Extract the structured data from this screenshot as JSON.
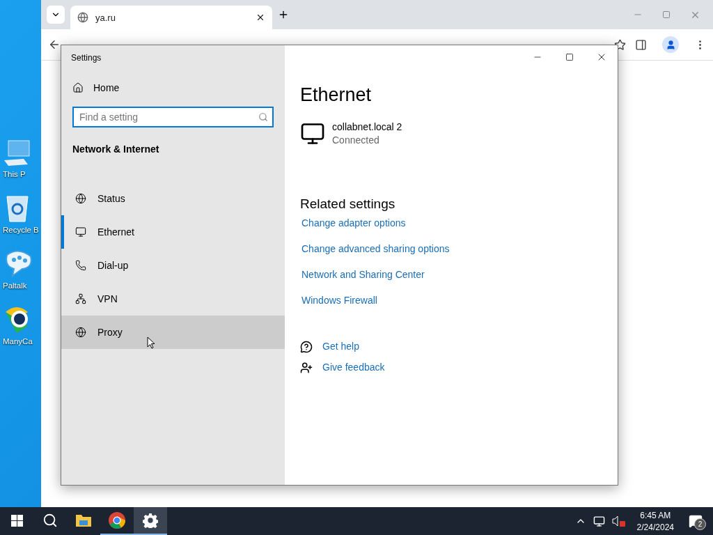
{
  "desktop_icons": [
    {
      "kind": "computer",
      "label": "This P"
    },
    {
      "kind": "recycle",
      "label": "Recycle B"
    },
    {
      "kind": "chat",
      "label": "Paltalk"
    },
    {
      "kind": "camera",
      "label": "ManyCa"
    }
  ],
  "browser": {
    "tabs": [
      {
        "title": "ya.ru",
        "selected": true
      }
    ]
  },
  "settings": {
    "title": "Settings",
    "home": "Home",
    "search": {
      "placeholder": "Find a setting"
    },
    "section": "Network & Internet",
    "nav": [
      {
        "kind": "status",
        "label": "Status",
        "selected": false,
        "hovered": false
      },
      {
        "kind": "ethernet",
        "label": "Ethernet",
        "selected": true,
        "hovered": false
      },
      {
        "kind": "dialup",
        "label": "Dial-up",
        "selected": false,
        "hovered": false
      },
      {
        "kind": "vpn",
        "label": "VPN",
        "selected": false,
        "hovered": false
      },
      {
        "kind": "proxy",
        "label": "Proxy",
        "selected": false,
        "hovered": true
      }
    ],
    "page_title": "Ethernet",
    "connection": {
      "name": "collabnet.local 2",
      "status": "Connected"
    },
    "related_heading": "Related settings",
    "related_links": [
      "Change adapter options",
      "Change advanced sharing options",
      "Network and Sharing Center",
      "Windows Firewall"
    ],
    "help_links": [
      {
        "kind": "help",
        "label": "Get help"
      },
      {
        "kind": "feedback",
        "label": "Give feedback"
      }
    ]
  },
  "taskbar": {
    "apps": [
      {
        "kind": "explorer",
        "running": false,
        "selected": false
      },
      {
        "kind": "chrome",
        "running": true,
        "selected": false
      },
      {
        "kind": "settings",
        "running": true,
        "selected": true
      }
    ]
  },
  "tray": {
    "time": "6:45 AM",
    "date": "2/24/2024",
    "notifications": "2"
  }
}
